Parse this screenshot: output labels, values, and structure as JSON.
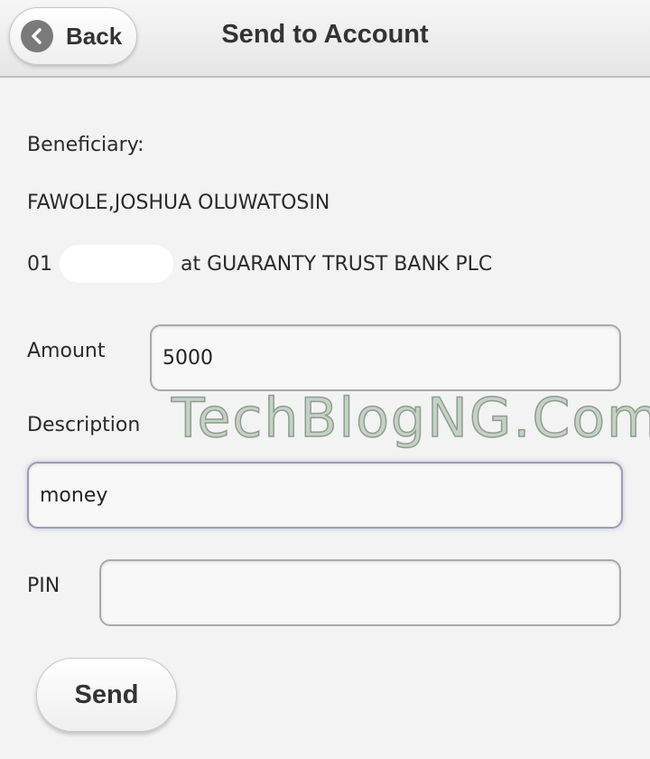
{
  "header": {
    "back_label": "Back",
    "title": "Send to Account"
  },
  "beneficiary": {
    "label": "Beneficiary:",
    "name": "FAWOLE,JOSHUA OLUWATOSIN",
    "account_prefix": "01",
    "bank_text": "at GUARANTY TRUST BANK PLC"
  },
  "form": {
    "amount_label": "Amount",
    "amount_value": "5000",
    "description_label": "Description",
    "description_value": "money",
    "pin_label": "PIN",
    "pin_value": "",
    "send_label": "Send"
  },
  "watermark": "TechBlogNG.Com",
  "icons": {
    "back": "chevron-left-icon"
  }
}
